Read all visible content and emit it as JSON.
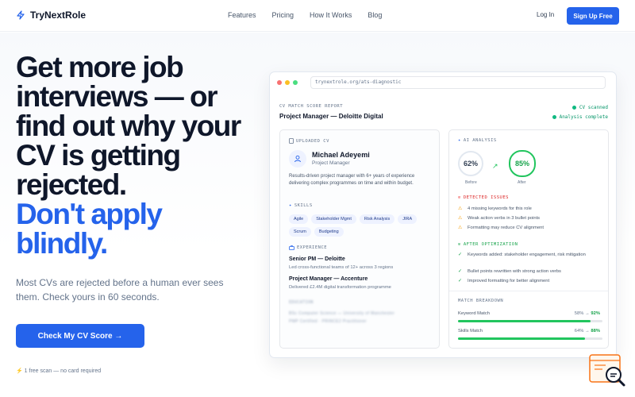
{
  "nav": {
    "brand": "TryNextRole",
    "links": [
      "Features",
      "Pricing",
      "How It Works",
      "Blog"
    ],
    "login": "Log In",
    "signup": "Sign Up Free"
  },
  "hero": {
    "headline_dark": "Get more job interviews — or find out why your CV is getting rejected.",
    "headline_blue": "Don't apply blindly.",
    "subtext": "Most CVs are rejected before a human ever sees them. Check yours in 60 seconds.",
    "cta": "Check My CV Score →",
    "note": "⚡ 1 free scan — no card required"
  },
  "window": {
    "url": "trynextrole.org/ats-diagnostic",
    "report_label": "CV MATCH SCORE REPORT",
    "report_title": "Project Manager — Deloitte Digital",
    "status": [
      "CV scanned",
      "Analysis complete"
    ]
  },
  "cv": {
    "section_label": "UPLOADED CV",
    "name": "Michael Adeyemi",
    "role": "Project Manager",
    "summary": "Results-driven project manager with 6+ years of experience delivering complex programmes on time and within budget.",
    "skills_label": "SKILLS",
    "skills": [
      "Agile",
      "Stakeholder Mgmt",
      "Risk Analysis",
      "JIRA",
      "Scrum",
      "Budgeting"
    ],
    "experience_label": "EXPERIENCE",
    "experience": [
      {
        "title": "Senior PM — Deloitte",
        "desc": "Led cross-functional teams of 12+ across 3 regions"
      },
      {
        "title": "Project Manager — Accenture",
        "desc": "Delivered £2.4M digital transformation programme"
      }
    ],
    "education_label": "EDUCATION",
    "education_lines": [
      "BSc Computer Science — University of Manchester",
      "PMP Certified · PRINCE2 Practitioner"
    ]
  },
  "analysis": {
    "section_label": "AI ANALYSIS",
    "before_score": "62%",
    "before_caption": "Before",
    "after_score": "85%",
    "after_caption": "After",
    "issues_label": "DETECTED ISSUES",
    "issues": [
      "4 missing keywords for this role",
      "Weak action verbs in 3 bullet points",
      "Formatting may reduce CV alignment"
    ],
    "optimization_label": "AFTER OPTIMIZATION",
    "optimizations": [
      "Keywords added: stakeholder engagement, risk mitigation",
      "Bullet points rewritten with strong action verbs",
      "Improved formatting for better alignment"
    ],
    "breakdown_label": "MATCH BREAKDOWN",
    "breakdown": [
      {
        "label": "Keyword Match",
        "from": "58%",
        "to": "92%",
        "fill": 0.92
      },
      {
        "label": "Skills Match",
        "from": "64%",
        "to": "88%",
        "fill": 0.88
      }
    ]
  },
  "colors": {
    "accent": "#2563eb",
    "success": "#22c55e",
    "warning": "#f59e0b",
    "danger": "#ef4444"
  }
}
